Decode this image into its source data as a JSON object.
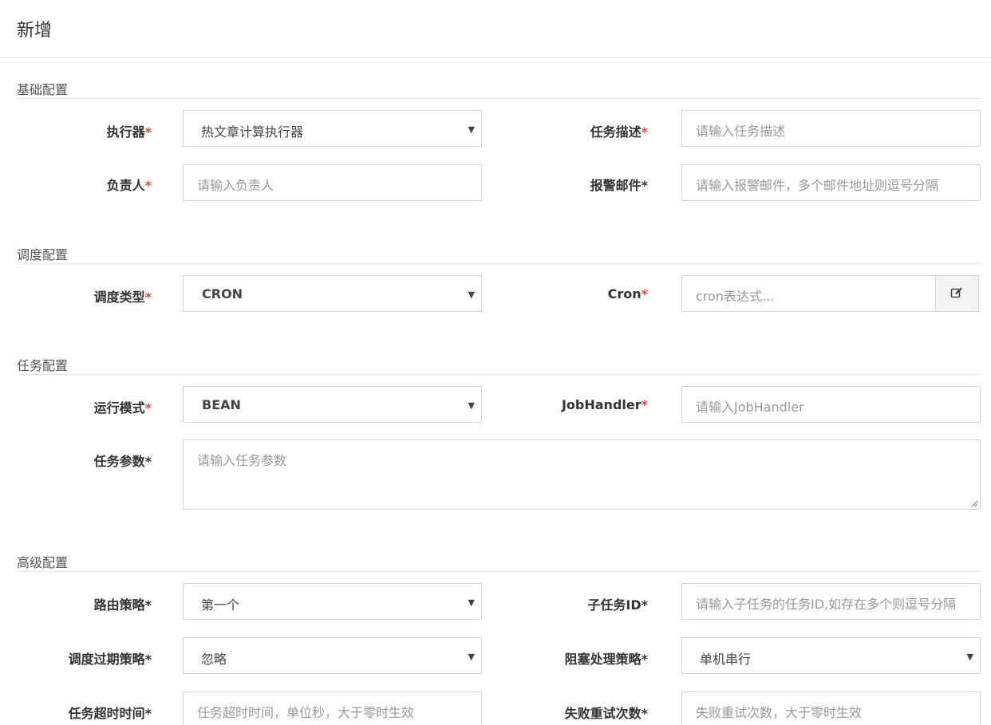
{
  "header": {
    "title": "新增"
  },
  "sections": {
    "basic": "基础配置",
    "schedule": "调度配置",
    "task": "任务配置",
    "advanced": "高级配置"
  },
  "basic": {
    "executor_label": "执行器",
    "executor_value": "热文章计算执行器",
    "desc_label": "任务描述",
    "desc_placeholder": "请输入任务描述",
    "owner_label": "负责人",
    "owner_placeholder": "请输入负责人",
    "email_label": "报警邮件",
    "email_placeholder": "请输入报警邮件，多个邮件地址则逗号分隔"
  },
  "schedule": {
    "type_label": "调度类型",
    "type_value": "CRON",
    "cron_label": "Cron",
    "cron_placeholder": "cron表达式..."
  },
  "task": {
    "mode_label": "运行模式",
    "mode_value": "BEAN",
    "handler_label": "JobHandler",
    "handler_placeholder": "请输入JobHandler",
    "params_label": "任务参数",
    "params_placeholder": "请输入任务参数"
  },
  "advanced": {
    "route_label": "路由策略",
    "route_value": "第一个",
    "child_label": "子任务ID",
    "child_placeholder": "请输入子任务的任务ID,如存在多个则逗号分隔",
    "misfire_label": "调度过期策略",
    "misfire_value": "忽略",
    "block_label": "阻塞处理策略",
    "block_value": "单机串行",
    "timeout_label": "任务超时时间",
    "timeout_placeholder": "任务超时时间，单位秒，大于零时生效",
    "retry_label": "失败重试次数",
    "retry_placeholder": "失败重试次数，大于零时生效"
  },
  "colors": {
    "required": "#dd4b39",
    "border": "#d2d6de",
    "placeholder": "#999999"
  },
  "icons": {
    "cron_edit": "edit-icon",
    "select_caret": "caret-down-icon"
  }
}
